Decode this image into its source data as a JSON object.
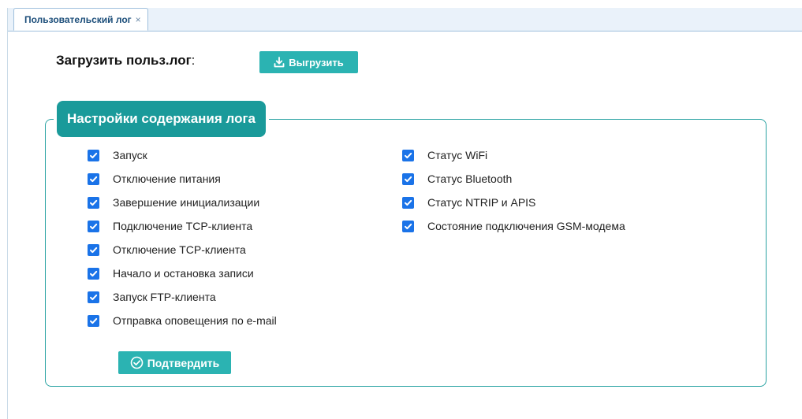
{
  "tab": {
    "label": "Пользовательский лог",
    "close_glyph": "×"
  },
  "upload": {
    "label": "Загрузить польз.лог",
    "colon": ":",
    "button_label": "Выгрузить",
    "button_icon": "download-icon"
  },
  "settings": {
    "legend": "Настройки содержания лога",
    "left_items": [
      {
        "label": "Запуск",
        "checked": true
      },
      {
        "label": "Отключение питания",
        "checked": true
      },
      {
        "label": "Завершение инициализации",
        "checked": true
      },
      {
        "label": "Подключение TCP-клиента",
        "checked": true
      },
      {
        "label": "Отключение TCP-клиента",
        "checked": true
      },
      {
        "label": "Начало и остановка записи",
        "checked": true
      },
      {
        "label": "Запуск FTP-клиента",
        "checked": true
      },
      {
        "label": "Отправка оповещения по e-mail",
        "checked": true
      }
    ],
    "right_items": [
      {
        "label": "Статус WiFi",
        "checked": true
      },
      {
        "label": "Статус Bluetooth",
        "checked": true
      },
      {
        "label": "Статус NTRIP и APIS",
        "checked": true
      },
      {
        "label": "Состояние подключения GSM-модема",
        "checked": true
      }
    ],
    "confirm_label": "Подтвердить",
    "confirm_icon": "check-circle-icon"
  },
  "colors": {
    "accent": "#2bb3b2",
    "legend": "#1a9a9a",
    "checkbox": "#1a73e8",
    "tab_text": "#1c4e7a"
  }
}
